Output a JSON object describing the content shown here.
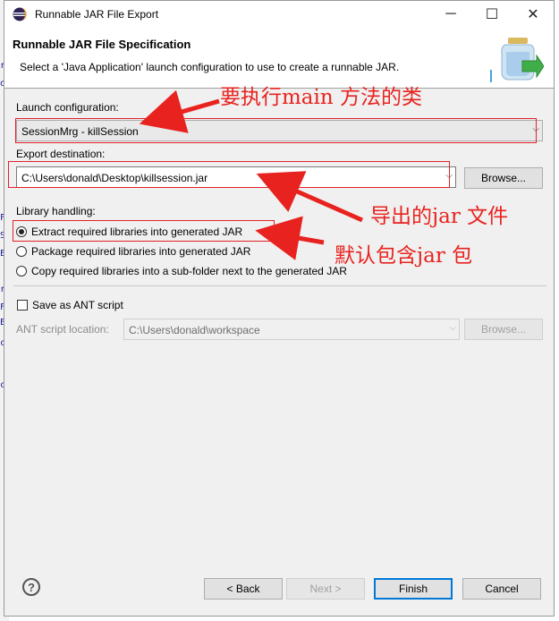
{
  "window": {
    "title": "Runnable JAR File Export",
    "min_glyph": "─",
    "max_glyph": "☐",
    "close_glyph": "✕"
  },
  "banner": {
    "title": "Runnable JAR File Specification",
    "description": "Select a 'Java Application' launch configuration to use to create a runnable JAR."
  },
  "launch": {
    "label": "Launch configuration:",
    "value": "SessionMrg - killSession"
  },
  "export": {
    "label": "Export destination:",
    "value": "C:\\Users\\donald\\Desktop\\killsession.jar",
    "browse_label": "Browse..."
  },
  "library": {
    "label": "Library handling:",
    "options": [
      "Extract required libraries into generated JAR",
      "Package required libraries into generated JAR",
      "Copy required libraries into a sub-folder next to the generated JAR"
    ],
    "selected_index": 0
  },
  "ant": {
    "checkbox_label": "Save as ANT script",
    "checked": false,
    "location_label": "ANT script location:",
    "location_value": "C:\\Users\\donald\\workspace",
    "browse_label": "Browse..."
  },
  "footer": {
    "help_glyph": "?",
    "back_label": "< Back",
    "next_label": "Next >",
    "finish_label": "Finish",
    "cancel_label": "Cancel"
  },
  "annotations": {
    "main_class": "要执行main 方法的类",
    "export_jar": "导出的jar 文件",
    "default_jar": "默认包含jar 包"
  },
  "colors": {
    "annotation": "#e8231f",
    "default_button_border": "#0078d7"
  },
  "background_marks": [
    "r",
    "o",
    "F",
    "S",
    "E",
    "r",
    "F",
    "E",
    "c",
    "c"
  ]
}
